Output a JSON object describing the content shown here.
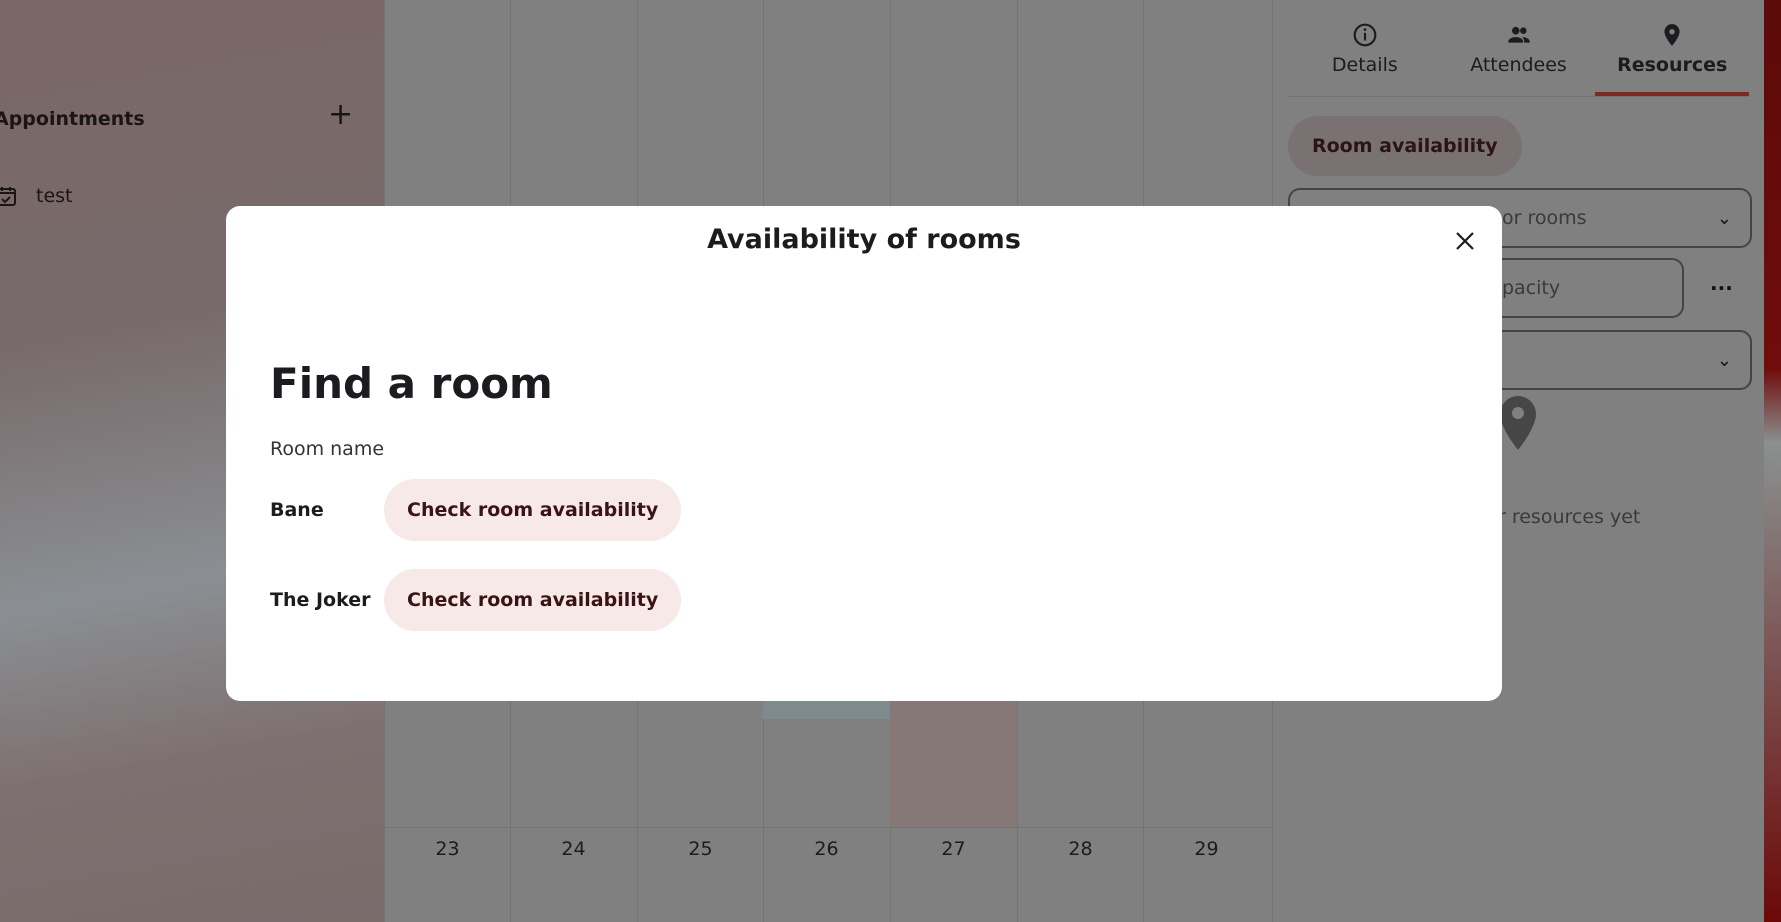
{
  "sidebar": {
    "heading": "Appointments",
    "items": [
      {
        "label": "test"
      }
    ]
  },
  "calendar": {
    "days": [
      "23",
      "24",
      "25",
      "26",
      "27",
      "28",
      "29"
    ]
  },
  "panel": {
    "tabs": [
      {
        "label": "Details",
        "icon": "info-icon"
      },
      {
        "label": "Attendees",
        "icon": "people-icon"
      },
      {
        "label": "Resources",
        "icon": "location-pin-icon",
        "active": true
      }
    ],
    "room_availability_label": "Room availability",
    "search_rooms_partial": "or rooms",
    "capacity_partial": "pacity",
    "empty_text_partial": "r resources yet"
  },
  "modal": {
    "title": "Availability of rooms",
    "heading": "Find a room",
    "column_label": "Room name",
    "rooms": [
      {
        "name": "Bane",
        "action": "Check room availability"
      },
      {
        "name": "The Joker",
        "action": "Check room availability"
      }
    ]
  },
  "colors": {
    "accent": "#7c2a22",
    "button_bg": "#f6e9e7"
  }
}
